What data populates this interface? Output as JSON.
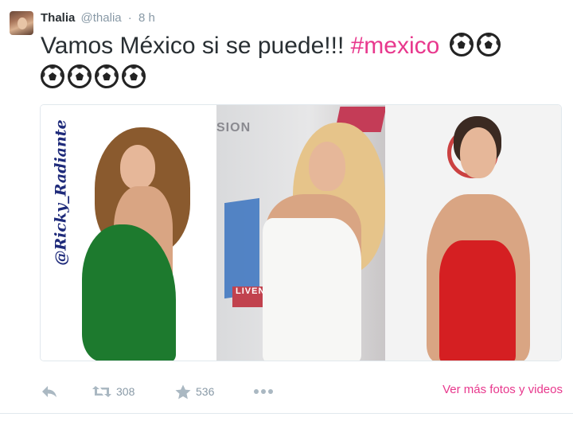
{
  "tweet": {
    "author_name": "Thalia",
    "author_handle": "@thalia",
    "separator": "·",
    "time": "8 h",
    "text_main": "Vamos México si se puede!!! ",
    "hashtag": "#mexico",
    "emoji": "soccer-ball"
  },
  "media": {
    "watermark": "@Ricky_Radiante",
    "logo_fragment": "SION",
    "sign_fragment": "LIVEN"
  },
  "actions": {
    "retweet_count": "308",
    "favorite_count": "536",
    "more_link": "Ver más fotos y videos"
  },
  "colors": {
    "accent": "#e8388d",
    "muted": "#8899a6",
    "text": "#292f33",
    "border": "#e1e8ed"
  }
}
